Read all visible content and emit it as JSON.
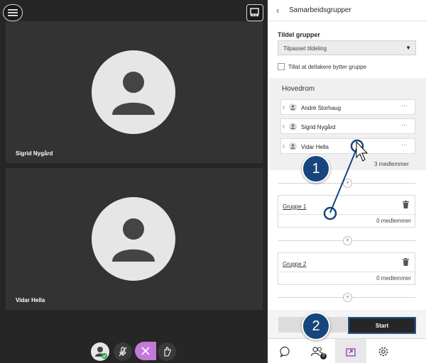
{
  "participants": [
    {
      "name": "Sigrid Nygård"
    },
    {
      "name": "Vidar Hella"
    }
  ],
  "panel": {
    "title": "Samarbeidsgrupper",
    "assign_label": "Tildel grupper",
    "assign_value": "Tilpasset tildeling",
    "allow_switch_label": "Tillat at deltakere bytter gruppe",
    "main_room": {
      "title": "Hovedrom",
      "members": [
        "André Storhaug",
        "Sigrid Nygård",
        "Vidar Hella"
      ],
      "count_label": "3 medlemmer"
    },
    "groups": [
      {
        "name": "Gruppe 1",
        "count_label": "0 medlemmer"
      },
      {
        "name": "Gruppe 2",
        "count_label": "0 medlemmer"
      }
    ],
    "start_label": "Start",
    "attendee_badge": "3"
  },
  "callouts": [
    "1",
    "2"
  ],
  "colors": {
    "accent": "#17467d",
    "close": "#c479d9",
    "start_bg": "#262626"
  }
}
